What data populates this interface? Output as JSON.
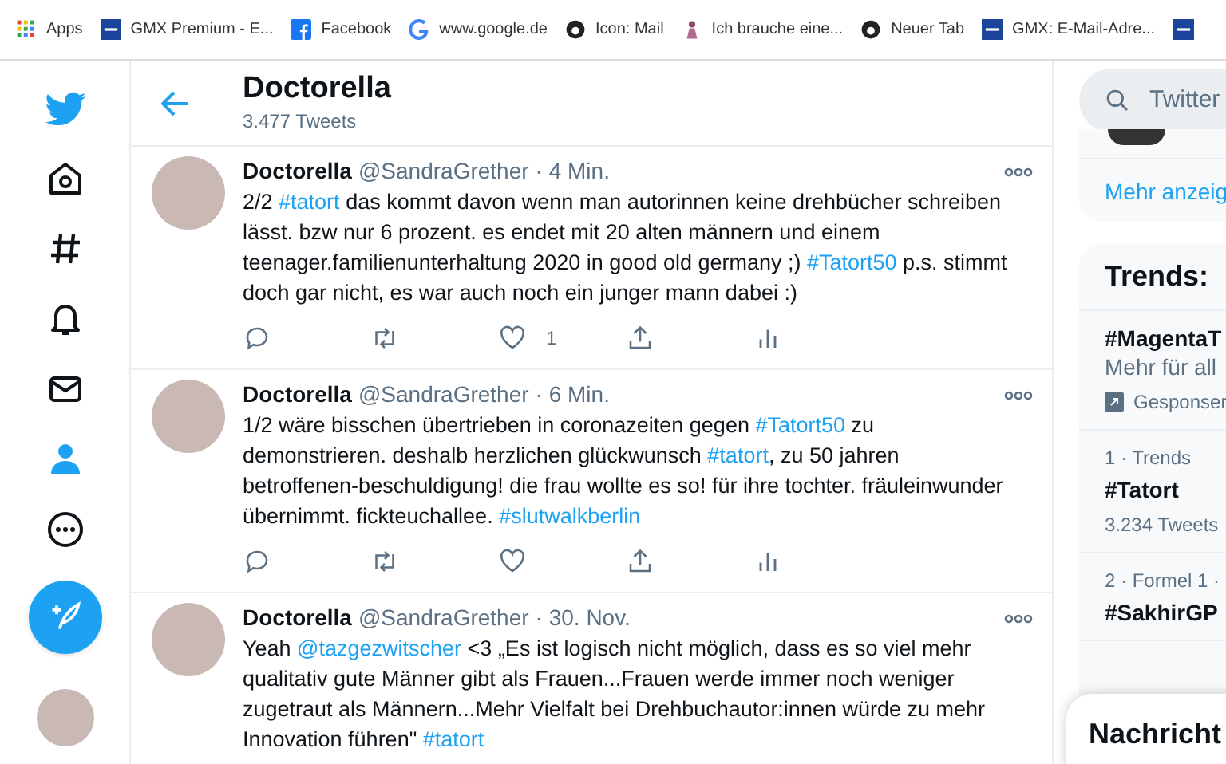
{
  "bookmarks": [
    {
      "label": "Apps"
    },
    {
      "label": "GMX Premium - E..."
    },
    {
      "label": "Facebook"
    },
    {
      "label": "www.google.de"
    },
    {
      "label": "Icon: Mail"
    },
    {
      "label": "Ich brauche eine..."
    },
    {
      "label": "Neuer Tab"
    },
    {
      "label": "GMX: E-Mail-Adre..."
    }
  ],
  "nav": [
    {
      "selected": false
    },
    {
      "selected": false
    },
    {
      "selected": false
    },
    {
      "selected": false
    },
    {
      "selected": true
    },
    {
      "selected": false
    }
  ],
  "header": {
    "title": "Doctorella",
    "subtitle": "3.477 Tweets"
  },
  "tweets": [
    {
      "name": "Doctorella",
      "handle": "@SandraGrether",
      "time": "· 4 Min.",
      "text": [
        {
          "kind": "text",
          "text": "2/2 "
        },
        {
          "kind": "link",
          "text": "#tatort"
        },
        {
          "kind": "text",
          "text": " das kommt davon wenn man autorinnen keine drehbücher schreiben lässt. bzw nur 6 prozent. es endet mit 20 alten männern und einem teenager.familienunterhaltung 2020 in good old germany ;) "
        },
        {
          "kind": "link",
          "text": "#Tatort50"
        },
        {
          "kind": "text",
          "text": " p.s. stimmt doch gar nicht, es war auch noch ein junger mann dabei :)"
        }
      ],
      "likes": "1"
    },
    {
      "name": "Doctorella",
      "handle": "@SandraGrether",
      "time": "· 6 Min.",
      "text": [
        {
          "kind": "text",
          "text": "1/2 wäre bisschen übertrieben in coronazeiten gegen "
        },
        {
          "kind": "link",
          "text": "#Tatort50"
        },
        {
          "kind": "text",
          "text": "  zu demonstrieren.  deshalb herzlichen glückwunsch "
        },
        {
          "kind": "link",
          "text": "#tatort"
        },
        {
          "kind": "text",
          "text": ", zu 50 jahren betroffenen-beschuldigung! die frau wollte es so! für ihre tochter. fräuleinwunder übernimmt. fickteuchallee. "
        },
        {
          "kind": "link",
          "text": "#slutwalkberlin"
        }
      ]
    },
    {
      "name": "Doctorella",
      "handle": "@SandraGrether",
      "time": "· 30. Nov.",
      "text": [
        {
          "kind": "text",
          "text": "Yeah "
        },
        {
          "kind": "link",
          "text": "@tazgezwitscher"
        },
        {
          "kind": "text",
          "text": " <3 „Es ist logisch nicht möglich, dass es so viel mehr qualitativ gute Männer gibt als Frauen...Frauen werde immer noch weniger zugetraut als Männern...Mehr Vielfalt bei Drehbuchautor:innen würde zu mehr Innovation führen\" "
        },
        {
          "kind": "link",
          "text": "#tatort"
        }
      ]
    }
  ],
  "search": {
    "placeholder": "Twitter"
  },
  "follow_card": {
    "link": "Mehr anzeig"
  },
  "trends": {
    "title": "Trends:",
    "items": [
      {
        "kind": "promoted",
        "name": "#MagentaT",
        "description": "Mehr für all",
        "promoted": "Gesponser"
      },
      {
        "kind": "trend",
        "context": "1 · Trends",
        "name": "#Tatort",
        "count": "3.234 Tweets"
      },
      {
        "kind": "trend",
        "context": "2 · Formel 1 ·",
        "name": "#SakhirGP"
      }
    ]
  },
  "messages": {
    "title": "Nachricht"
  }
}
